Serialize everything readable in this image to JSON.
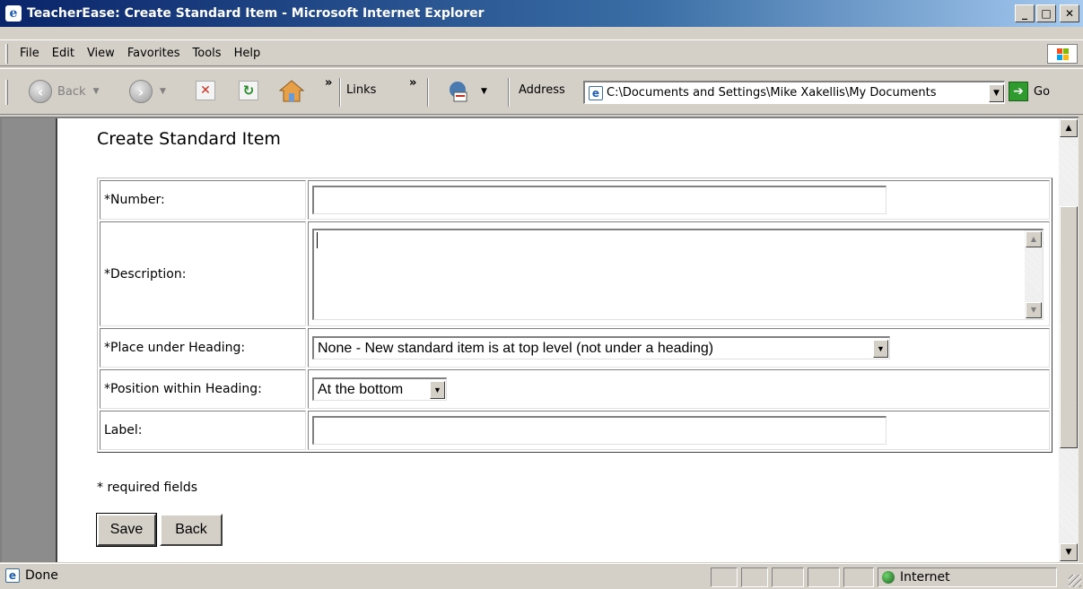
{
  "window": {
    "title": "TeacherEase: Create Standard Item - Microsoft Internet Explorer",
    "minimize": "_",
    "maximize": "□",
    "close": "✕"
  },
  "menu": {
    "items": [
      {
        "label": "File"
      },
      {
        "label": "Edit"
      },
      {
        "label": "View"
      },
      {
        "label": "Favorites"
      },
      {
        "label": "Tools"
      },
      {
        "label": "Help"
      }
    ]
  },
  "toolbar": {
    "back_label": "Back",
    "chevron": "»",
    "links_label": "Links",
    "address_label": "Address",
    "address_value": "C:\\Documents and Settings\\Mike Xakellis\\My Documents",
    "go_label": "Go"
  },
  "page": {
    "title": "Create Standard Item",
    "fields": {
      "number_label": "*Number:",
      "description_label": "*Description:",
      "heading_label": "*Place under Heading:",
      "heading_value": "None - New standard item is at top level (not under a heading)",
      "position_label": "*Position within Heading:",
      "position_value": "At the bottom",
      "label_label": "Label:"
    },
    "required_note": "* required fields",
    "save_button": "Save",
    "back_button": "Back"
  },
  "status": {
    "text": "Done",
    "zone": "Internet"
  },
  "icons": {
    "ie": "ie-icon",
    "back": "back-arrow-icon",
    "forward": "forward-arrow-icon",
    "stop": "stop-icon",
    "refresh": "refresh-icon",
    "home": "home-icon",
    "go": "go-arrow-icon"
  }
}
